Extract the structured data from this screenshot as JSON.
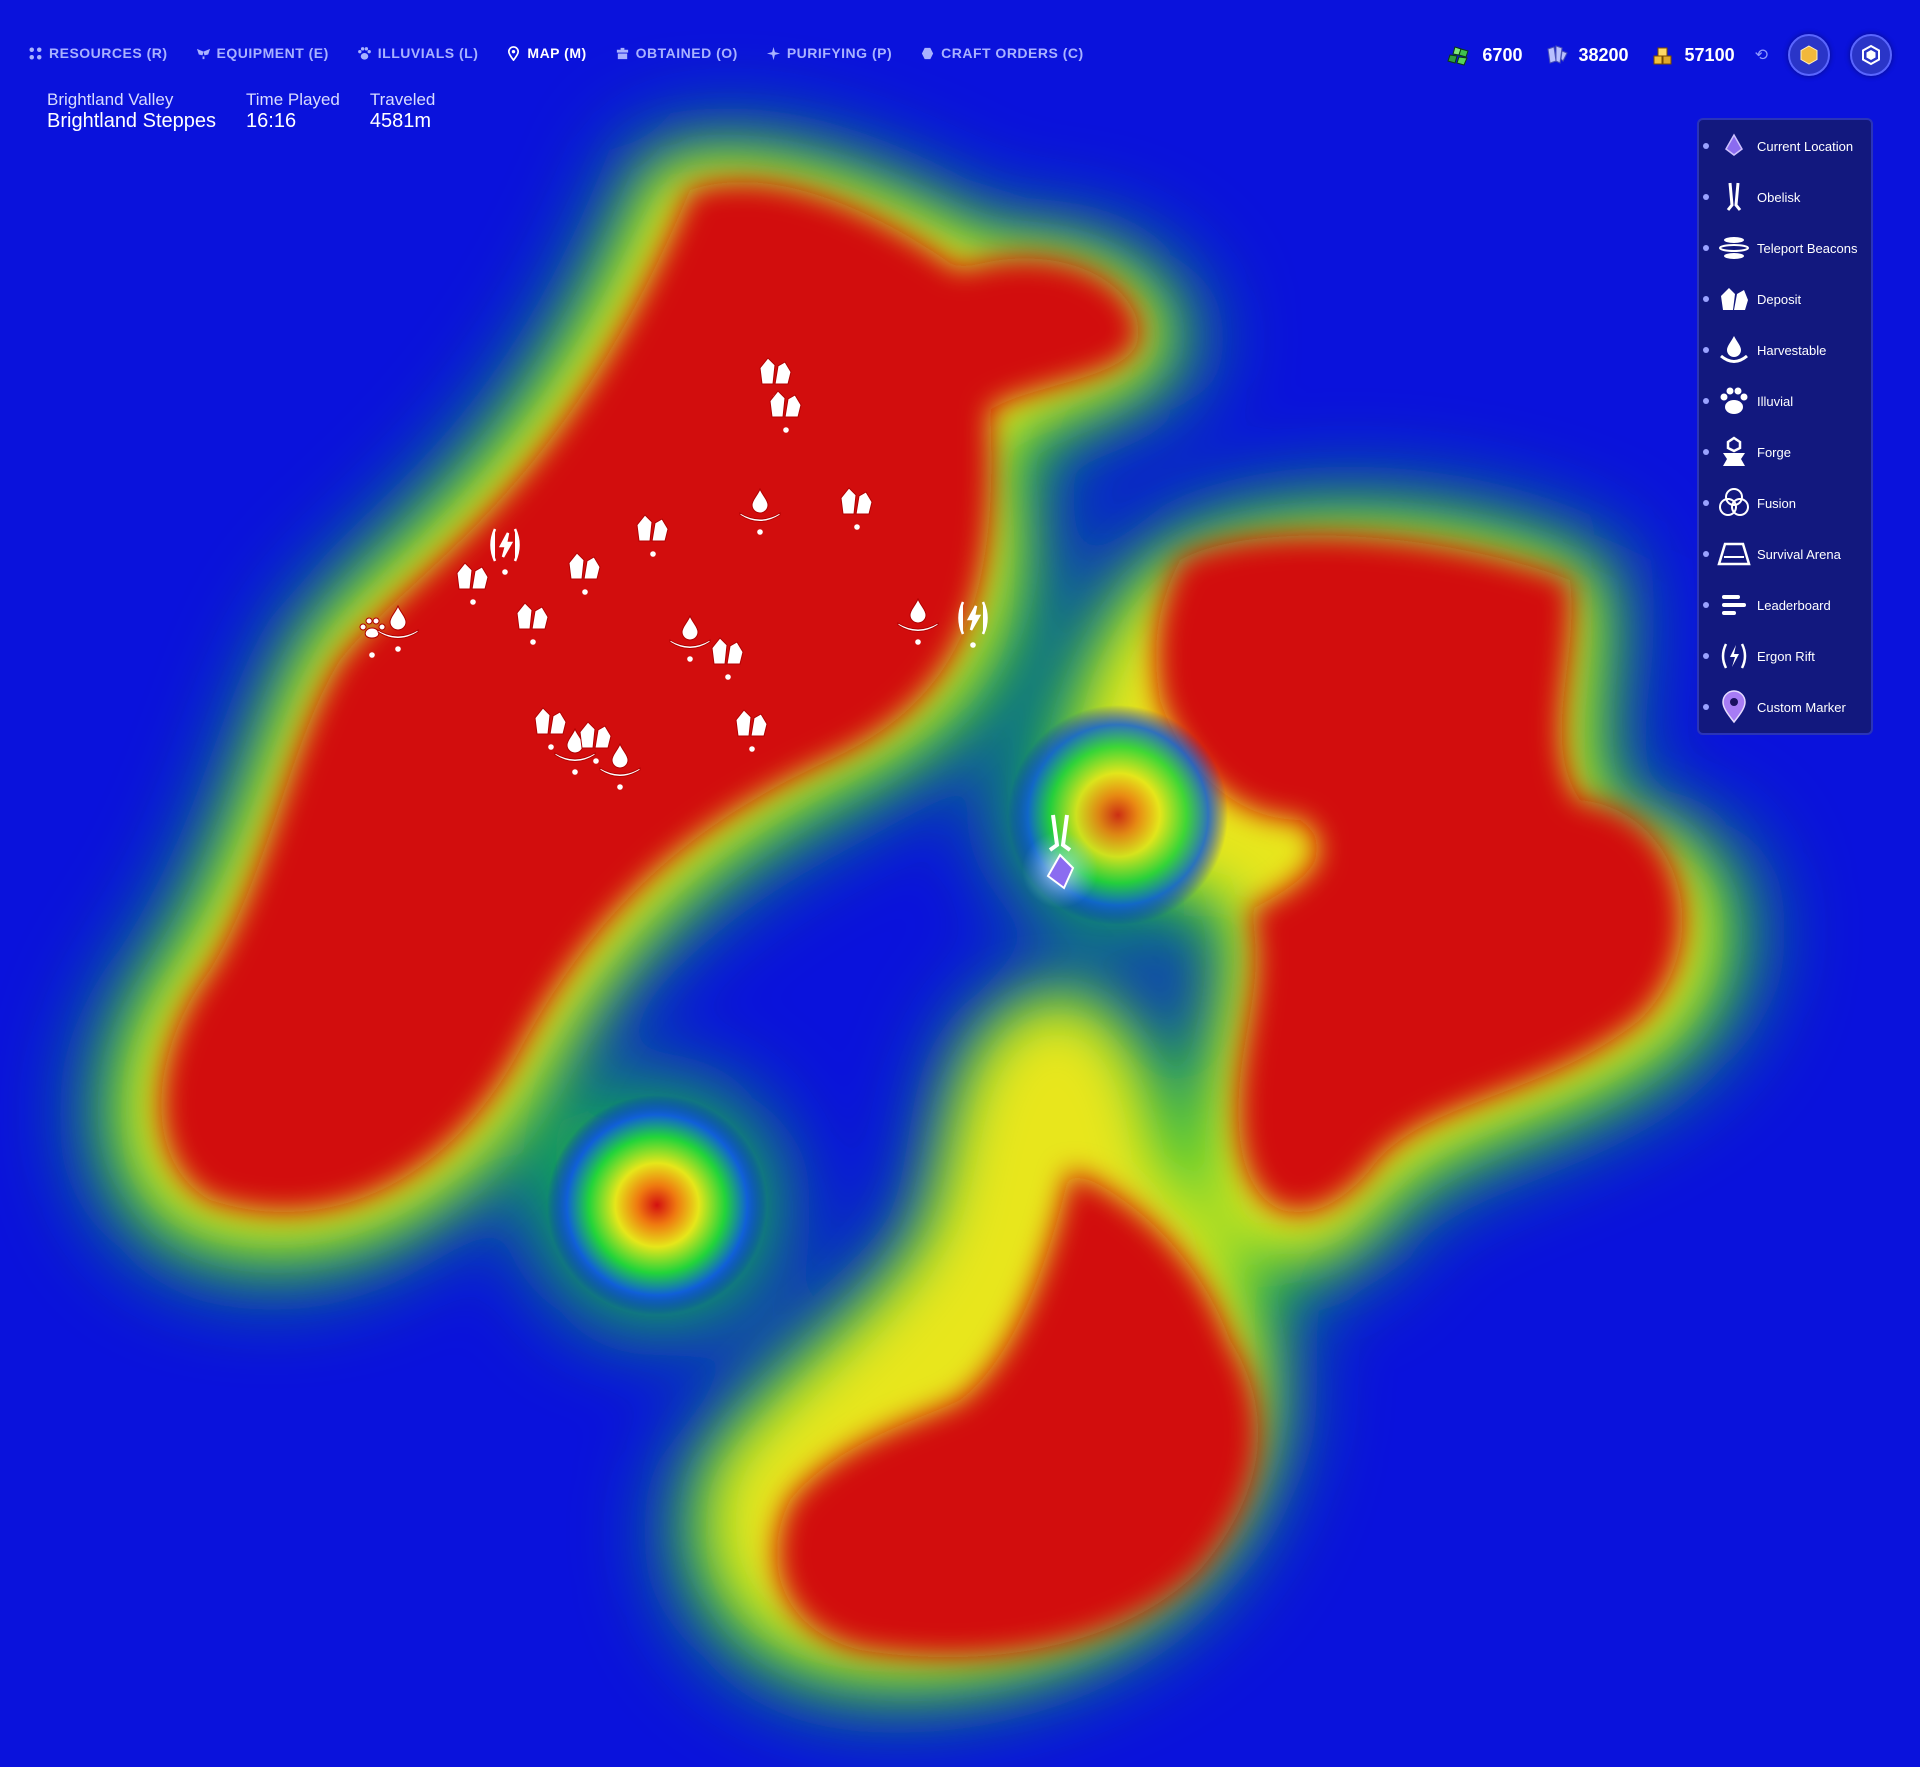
{
  "nav": {
    "items": [
      {
        "label": "RESOURCES (R)",
        "icon": "grid-icon",
        "active": false
      },
      {
        "label": "EQUIPMENT (E)",
        "icon": "wings-icon",
        "active": false
      },
      {
        "label": "ILLUVIALS (L)",
        "icon": "paw-icon",
        "active": false
      },
      {
        "label": "MAP (M)",
        "icon": "map-pin-icon",
        "active": true
      },
      {
        "label": "OBTAINED (O)",
        "icon": "box-icon",
        "active": false
      },
      {
        "label": "PURIFYING (P)",
        "icon": "purify-icon",
        "active": false
      },
      {
        "label": "CRAFT ORDERS (C)",
        "icon": "craft-icon",
        "active": false
      }
    ]
  },
  "currencies": [
    {
      "icon": "gem-cluster-icon",
      "value": "6700",
      "color": "#3fbf4f"
    },
    {
      "icon": "crystal-shard-icon",
      "value": "38200",
      "color": "#8f99ff"
    },
    {
      "icon": "gold-stack-icon",
      "value": "57100",
      "color": "#f2c13b"
    }
  ],
  "info": {
    "region": "Brightland Valley",
    "area": "Brightland Steppes",
    "time_label": "Time Played",
    "time_value": "16:16",
    "traveled_label": "Traveled",
    "traveled_value": "4581m"
  },
  "legend": {
    "items": [
      {
        "label": "Current Location",
        "icon": "current-location-icon"
      },
      {
        "label": "Obelisk",
        "icon": "obelisk-icon"
      },
      {
        "label": "Teleport Beacons",
        "icon": "teleport-beacon-icon"
      },
      {
        "label": "Deposit",
        "icon": "deposit-icon"
      },
      {
        "label": "Harvestable",
        "icon": "harvestable-icon"
      },
      {
        "label": "Illuvial",
        "icon": "illuvial-icon"
      },
      {
        "label": "Forge",
        "icon": "forge-icon"
      },
      {
        "label": "Fusion",
        "icon": "fusion-icon"
      },
      {
        "label": "Survival Arena",
        "icon": "survival-arena-icon"
      },
      {
        "label": "Leaderboard",
        "icon": "leaderboard-icon"
      },
      {
        "label": "Ergon Rift",
        "icon": "ergon-rift-icon"
      },
      {
        "label": "Custom Marker",
        "icon": "custom-marker-icon"
      }
    ]
  },
  "colors": {
    "background": "#0a12dc",
    "heat_low": "#0a12dc",
    "heat_mid": "#18d23a",
    "heat_high": "#e8e812",
    "heat_peak": "#cc0808",
    "legend_bg": "#12187e",
    "nav_inactive": "#a9b2ff",
    "nav_active": "#ffffff"
  }
}
